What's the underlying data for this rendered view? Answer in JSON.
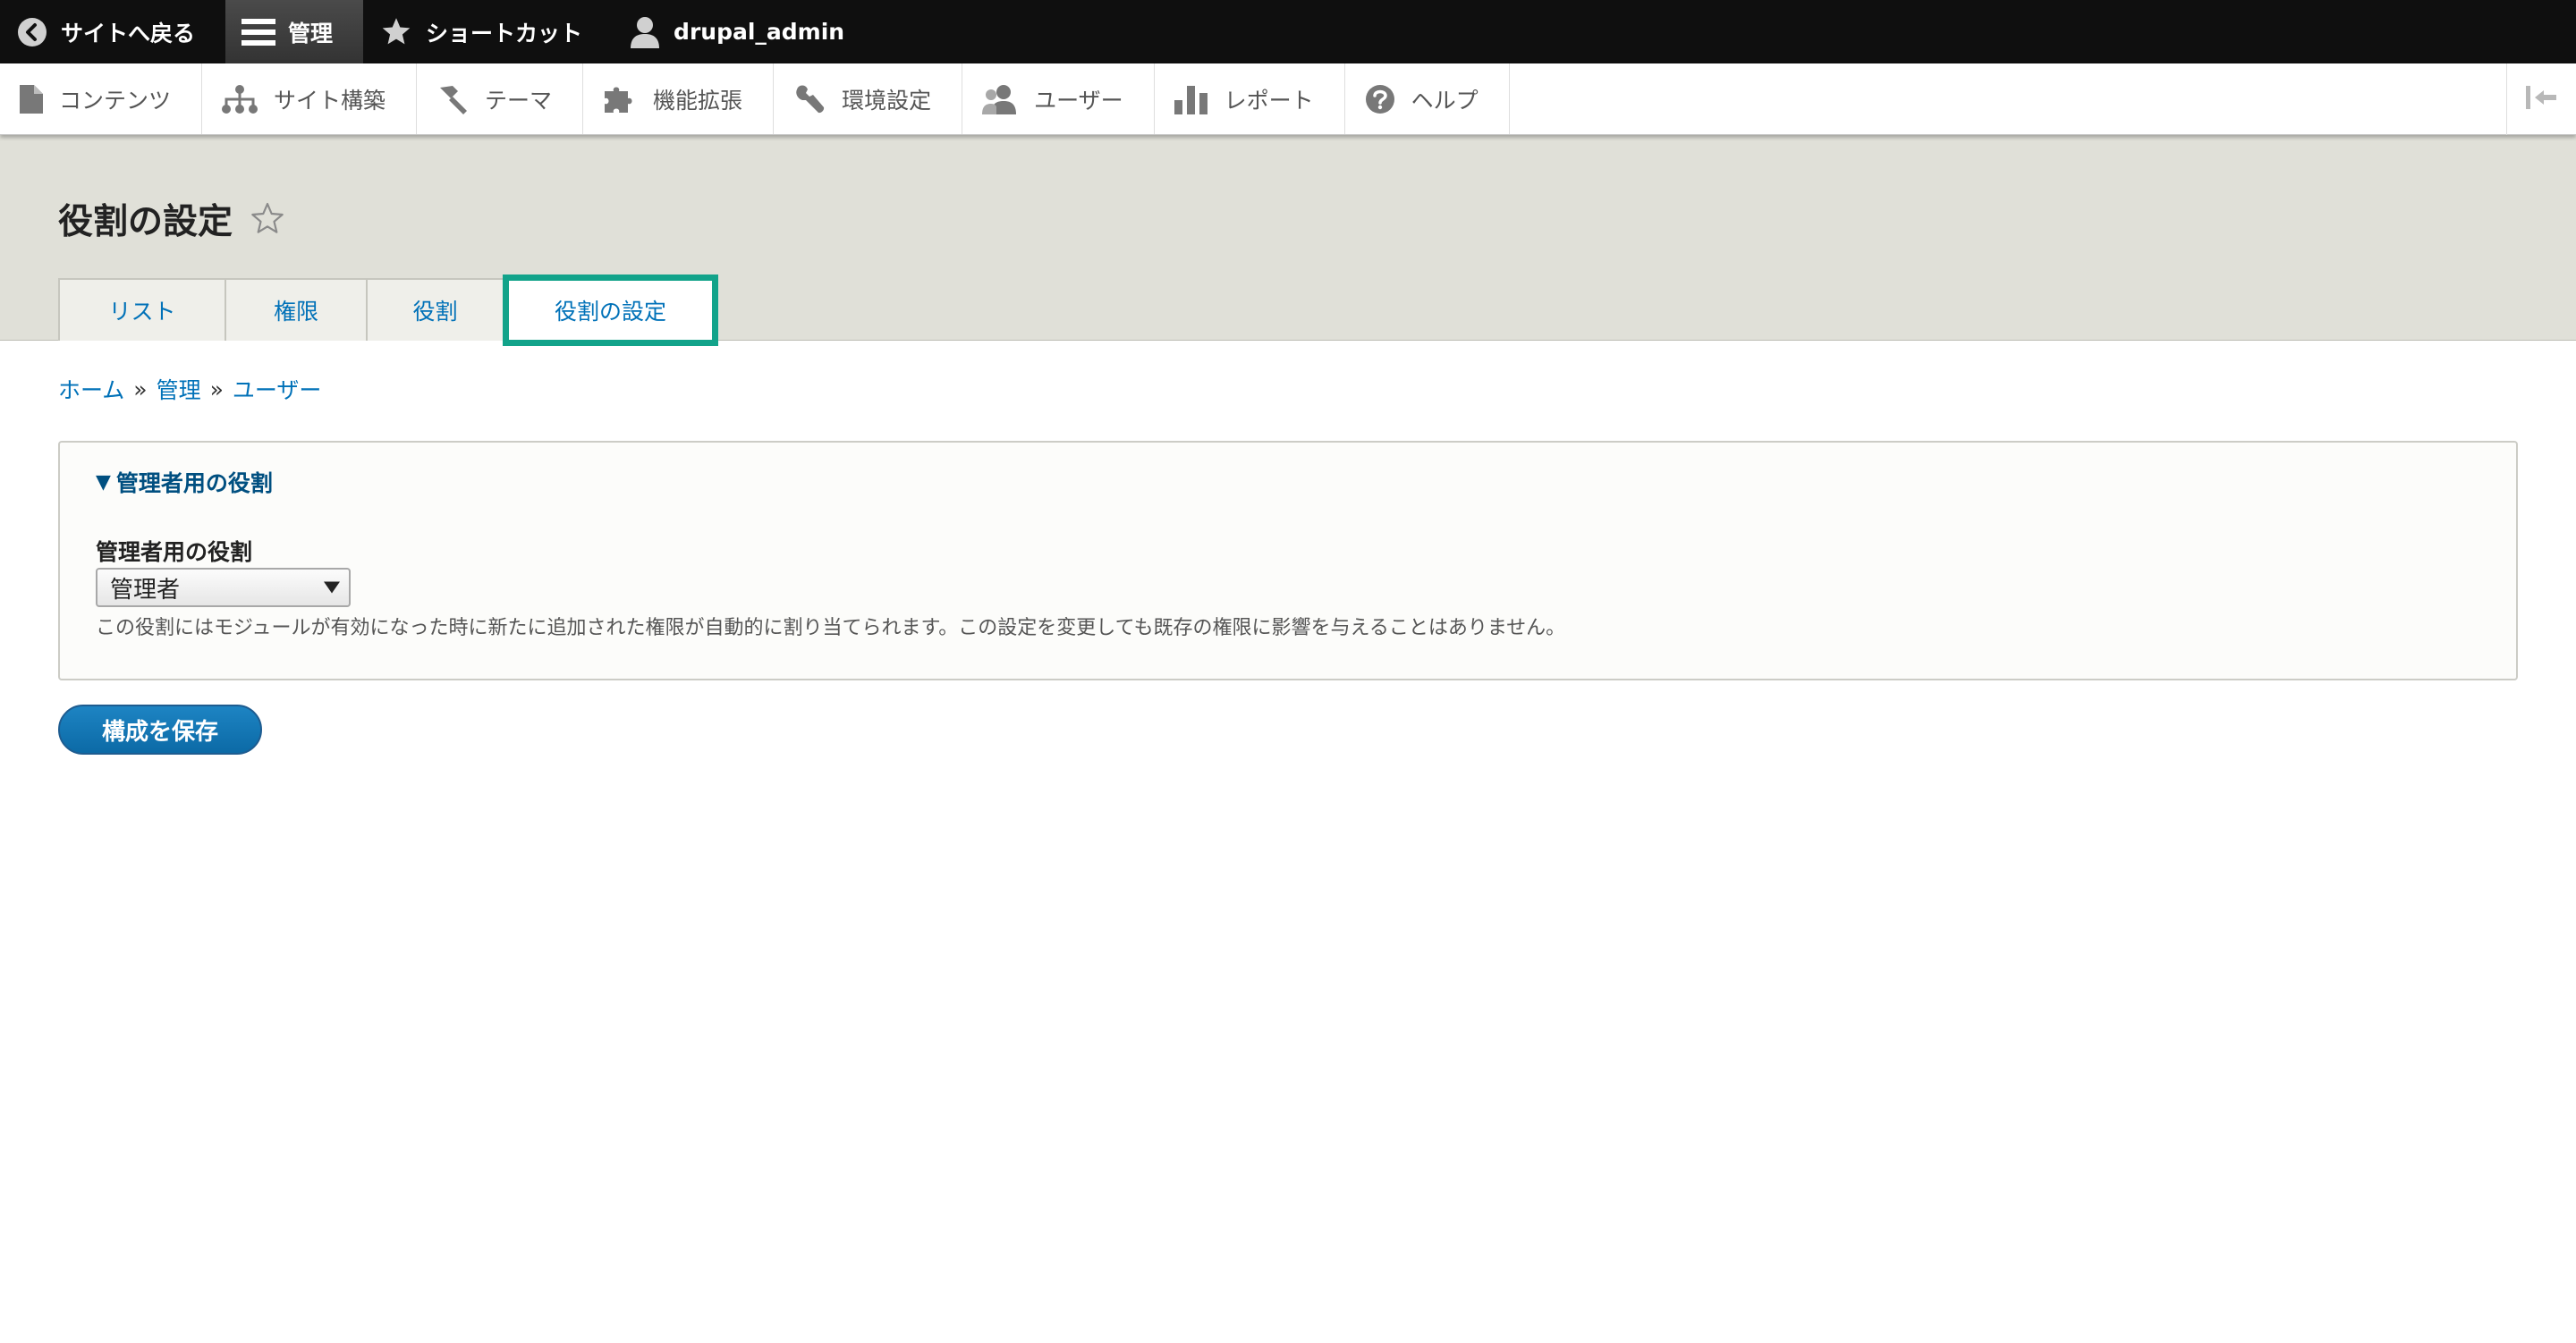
{
  "toolbar": {
    "back_label": "サイトへ戻る",
    "manage_label": "管理",
    "shortcuts_label": "ショートカット",
    "user_label": "drupal_admin"
  },
  "tray": {
    "items": [
      {
        "label": "コンテンツ",
        "icon": "document-icon"
      },
      {
        "label": "サイト構築",
        "icon": "sitemap-icon"
      },
      {
        "label": "テーマ",
        "icon": "paintbrush-icon"
      },
      {
        "label": "機能拡張",
        "icon": "puzzle-icon"
      },
      {
        "label": "環境設定",
        "icon": "wrench-icon"
      },
      {
        "label": "ユーザー",
        "icon": "people-icon"
      },
      {
        "label": "レポート",
        "icon": "bar-chart-icon"
      },
      {
        "label": "ヘルプ",
        "icon": "help-icon"
      }
    ]
  },
  "page": {
    "title": "役割の設定"
  },
  "tabs": [
    {
      "label": "リスト"
    },
    {
      "label": "権限"
    },
    {
      "label": "役割"
    },
    {
      "label": "役割の設定",
      "active": true
    }
  ],
  "breadcrumb": {
    "items": [
      "ホーム",
      "管理",
      "ユーザー"
    ],
    "separator": "»"
  },
  "form": {
    "fieldset_legend": "管理者用の役割",
    "field_label": "管理者用の役割",
    "select_value": "管理者",
    "description": "この役割にはモジュールが有効になった時に新たに追加された権限が自動的に割り当てられます。この設定を変更しても既存の権限に影響を与えることはありません。",
    "submit_label": "構成を保存"
  },
  "colors": {
    "toolbar_bg": "#0f0f0f",
    "link": "#0071b8",
    "active_tab_highlight": "#12a38a",
    "primary_button": "#0c6aa6"
  }
}
